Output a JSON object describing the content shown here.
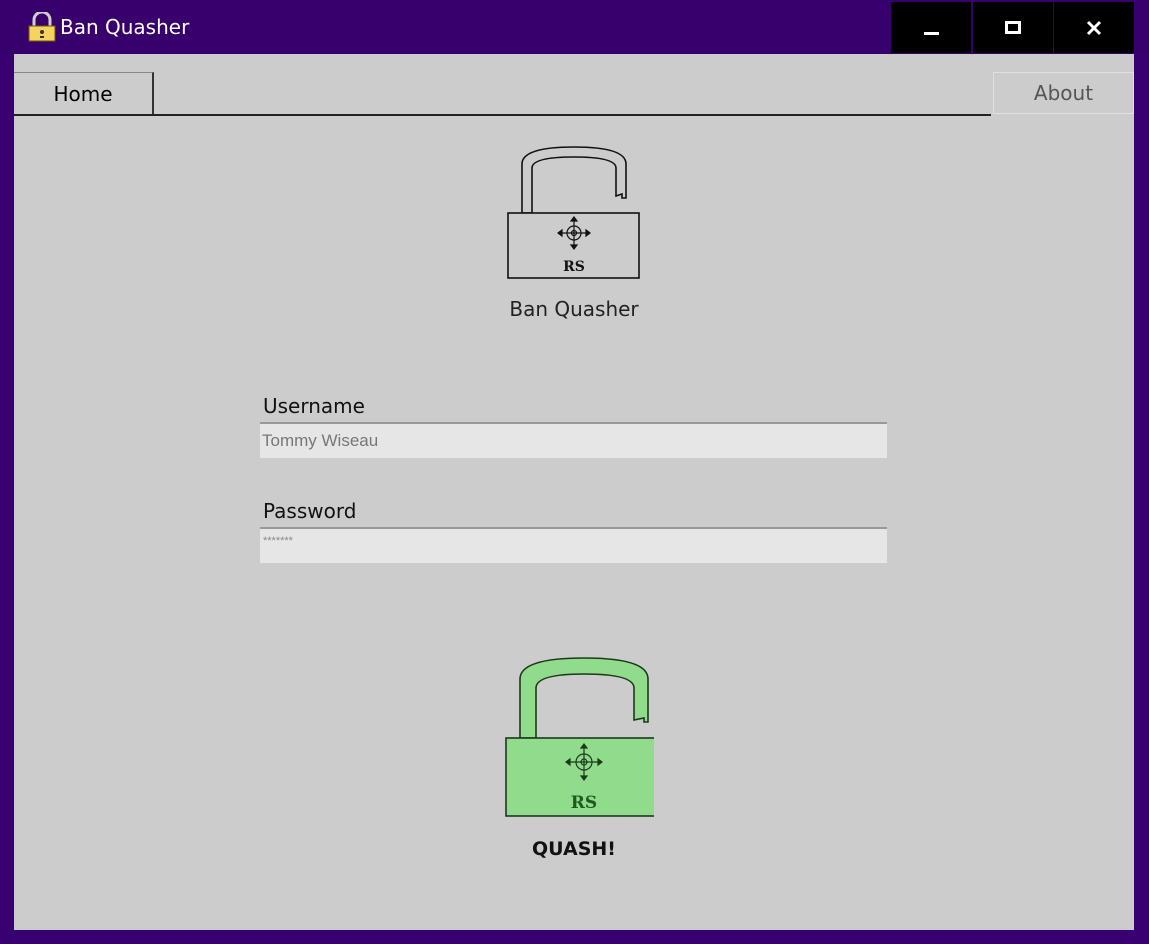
{
  "window": {
    "title": "Ban Quasher",
    "icon": "padlock-icon",
    "controls": [
      "minimize-icon",
      "maximize-icon",
      "close-icon"
    ]
  },
  "tabs": {
    "home_label": "Home",
    "about_label": "About"
  },
  "logo": {
    "emblem_text": "RS",
    "app_name": "Ban Quasher"
  },
  "form": {
    "username_label": "Username",
    "username_value": "Tommy Wiseau",
    "password_label": "Password",
    "password_value": "*******"
  },
  "quash": {
    "emblem_text": "RS",
    "label": "QUASH!"
  },
  "colors": {
    "titlebar": "#38006c",
    "client_bg": "#cccccc",
    "input_bg": "#e6e6e6",
    "lock_green": "#90dc8c",
    "lock_green_text": "#1d5a1d"
  }
}
